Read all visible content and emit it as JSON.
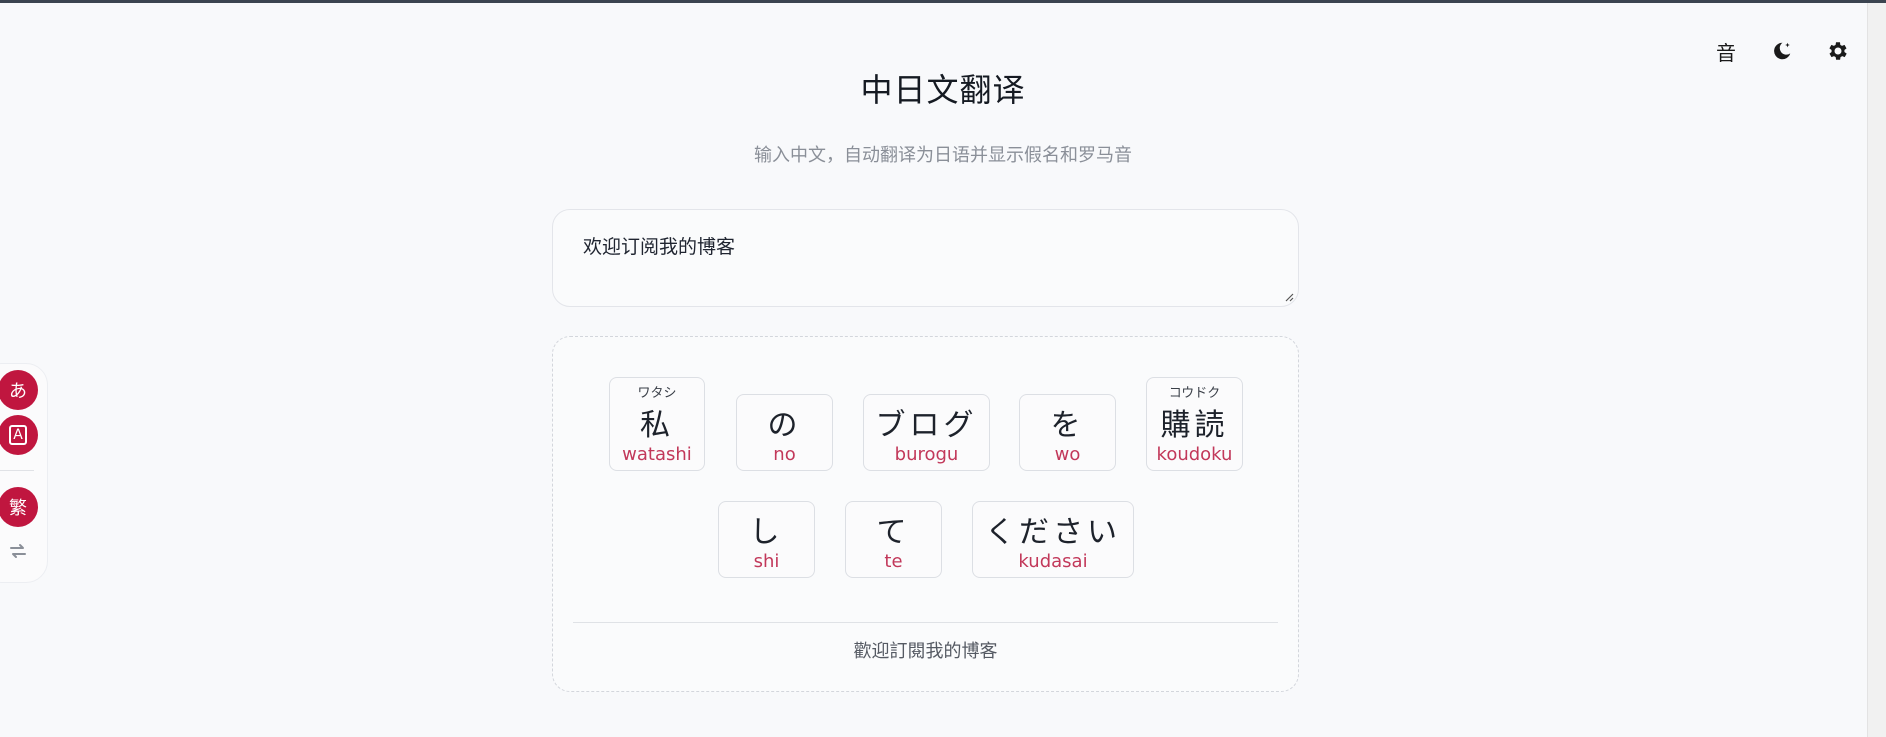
{
  "header": {
    "title": "中日文翻译",
    "subtitle": "输入中文，自动翻译为日语并显示假名和罗马音"
  },
  "toolbar": {
    "sound_label": "音",
    "dark_mode_icon": "moon-icon",
    "settings_icon": "gear-icon"
  },
  "input": {
    "value": "欢迎订阅我的博客"
  },
  "result": {
    "tokens": [
      {
        "ruby": "ワタシ",
        "text": "私",
        "romaji": "watashi"
      },
      {
        "ruby": "",
        "text": "の",
        "romaji": "no"
      },
      {
        "ruby": "",
        "text": "ブログ",
        "romaji": "burogu"
      },
      {
        "ruby": "",
        "text": "を",
        "romaji": "wo"
      },
      {
        "ruby": "コウドク",
        "text": "購読",
        "romaji": "koudoku"
      },
      {
        "ruby": "",
        "text": "し",
        "romaji": "shi"
      },
      {
        "ruby": "",
        "text": "て",
        "romaji": "te"
      },
      {
        "ruby": "",
        "text": "ください",
        "romaji": "kudasai"
      }
    ],
    "traditional": "歡迎訂閱我的博客"
  },
  "side_panel": {
    "hiragana_label": "あ",
    "romaji_label": "A",
    "traditional_label": "繁",
    "swap_icon": "swap-arrows-icon"
  },
  "colors": {
    "accent": "#c0163f",
    "romaji": "#c2385a",
    "background": "#f8f9fb"
  }
}
